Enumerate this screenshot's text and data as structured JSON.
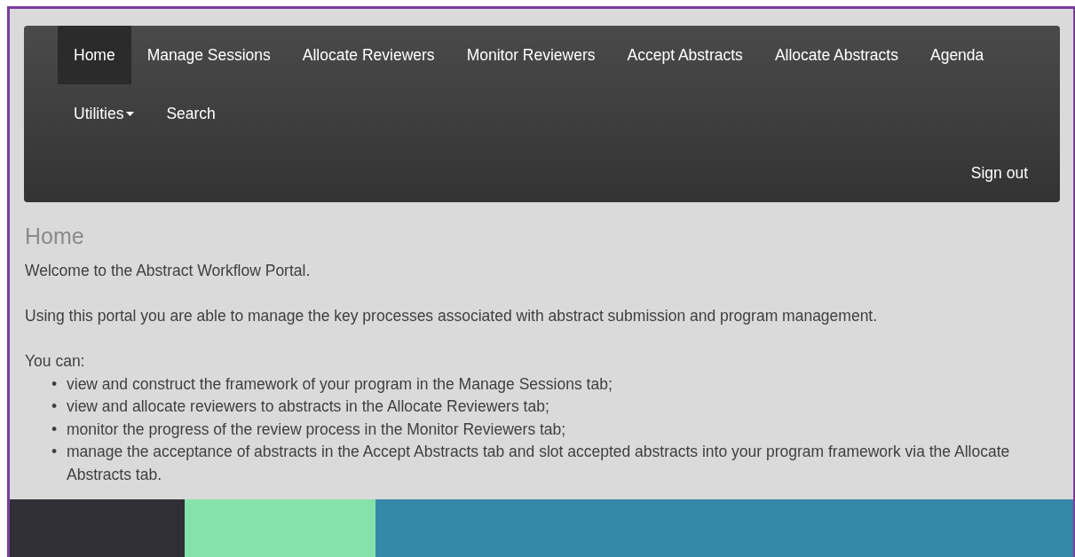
{
  "nav": {
    "items": [
      {
        "label": "Home",
        "selected": true,
        "kind": "link"
      },
      {
        "label": "Manage Sessions",
        "selected": false,
        "kind": "link"
      },
      {
        "label": "Allocate Reviewers",
        "selected": false,
        "kind": "link"
      },
      {
        "label": "Monitor Reviewers",
        "selected": false,
        "kind": "link"
      },
      {
        "label": "Accept Abstracts",
        "selected": false,
        "kind": "link"
      },
      {
        "label": "Allocate Abstracts",
        "selected": false,
        "kind": "link"
      },
      {
        "label": "Agenda",
        "selected": false,
        "kind": "link"
      },
      {
        "label": "Utilities",
        "selected": false,
        "kind": "dropdown"
      },
      {
        "label": "Search",
        "selected": false,
        "kind": "link"
      }
    ],
    "sign_out": "Sign out"
  },
  "page": {
    "heading": "Home",
    "paragraphs": [
      "Welcome to the Abstract Workflow Portal.",
      "Using this portal you are able to manage the key processes associated with abstract submission and program management.",
      "You can:"
    ],
    "list": [
      {
        "marker": "•",
        "text": "view and construct the framework of your program in the Manage Sessions tab;"
      },
      {
        "marker": "•",
        "text": "view and allocate reviewers to abstracts in the Allocate Reviewers tab;"
      },
      {
        "marker": "•",
        "text": "monitor the progress of the review process in the Monitor Reviewers tab;"
      },
      {
        "marker": "•",
        "text": "manage the acceptance of abstracts in the Accept Abstracts tab and slot accepted abstracts into your program framework via the Allocate Abstracts tab."
      }
    ]
  }
}
